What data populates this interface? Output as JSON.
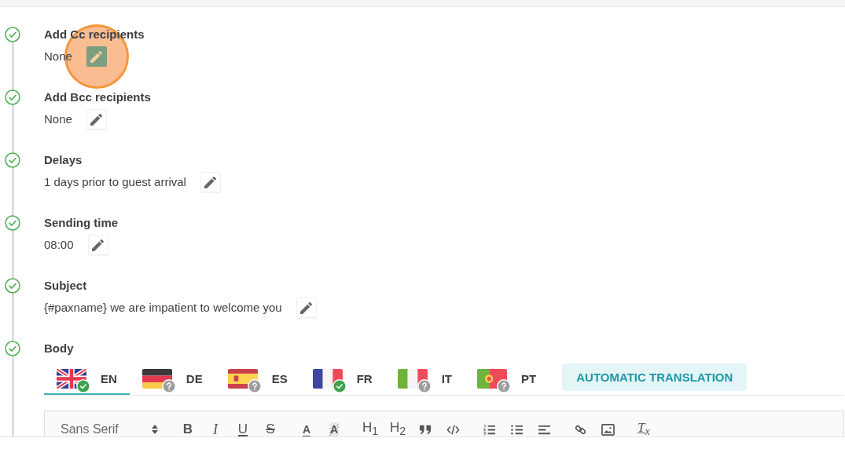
{
  "steps": [
    {
      "title": "Add Cc recipients",
      "value": "None",
      "done": true,
      "highlighted": true
    },
    {
      "title": "Add Bcc recipients",
      "value": "None",
      "done": true,
      "highlighted": false
    },
    {
      "title": "Delays",
      "value": "1 days prior to guest arrival",
      "done": true,
      "highlighted": false
    },
    {
      "title": "Sending time",
      "value": "08:00",
      "done": true,
      "highlighted": false
    },
    {
      "title": "Subject",
      "value": "{#paxname} we are impatient to welcome you",
      "done": true,
      "highlighted": false
    }
  ],
  "body": {
    "title": "Body",
    "done": true,
    "languages": [
      {
        "code": "EN",
        "selected": true,
        "translated": true
      },
      {
        "code": "DE",
        "selected": false,
        "translated": false
      },
      {
        "code": "ES",
        "selected": false,
        "translated": false
      },
      {
        "code": "FR",
        "selected": false,
        "translated": true
      },
      {
        "code": "IT",
        "selected": false,
        "translated": false
      },
      {
        "code": "PT",
        "selected": false,
        "translated": false
      }
    ],
    "auto_translate": "AUTOMATIC TRANSLATION",
    "toolbar": {
      "font": "Sans Serif",
      "groups": [
        [
          {
            "kind": "bold",
            "label": "B"
          },
          {
            "kind": "italic",
            "label": "I"
          },
          {
            "kind": "underline",
            "label": "U"
          },
          {
            "kind": "strike",
            "label": "S"
          }
        ],
        [
          {
            "kind": "color",
            "label": "A"
          },
          {
            "kind": "background",
            "label": "A"
          }
        ],
        [
          {
            "kind": "header",
            "label": "H$_{1}$"
          },
          {
            "kind": "header",
            "label": "H$_{2}$"
          },
          {
            "kind": "quote"
          },
          {
            "kind": "code"
          }
        ],
        [
          {
            "kind": "ordered-list"
          },
          {
            "kind": "bullet-list"
          },
          {
            "kind": "align"
          }
        ],
        [
          {
            "kind": "link"
          },
          {
            "kind": "image"
          }
        ],
        [
          {
            "kind": "clean",
            "label": "T$_{x}$"
          }
        ]
      ]
    }
  }
}
